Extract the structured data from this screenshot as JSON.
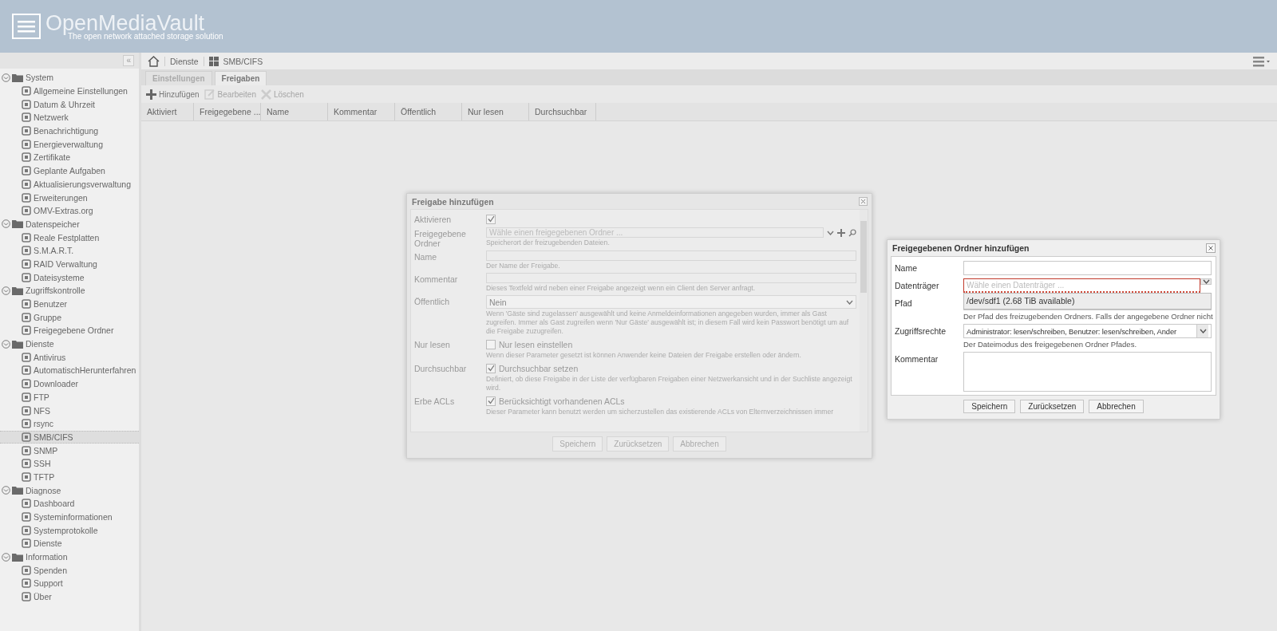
{
  "header": {
    "logo": "OpenMediaVault",
    "tagline": "The open network attached storage solution"
  },
  "sidebar": {
    "collapse": "«",
    "items": [
      {
        "label": "System",
        "expanded": true,
        "children": [
          {
            "label": "Allgemeine Einstellungen",
            "selected": false
          },
          {
            "label": "Datum & Uhrzeit",
            "selected": false
          },
          {
            "label": "Netzwerk",
            "selected": false
          },
          {
            "label": "Benachrichtigung",
            "selected": false
          },
          {
            "label": "Energieverwaltung",
            "selected": false
          },
          {
            "label": "Zertifikate",
            "selected": false
          },
          {
            "label": "Geplante Aufgaben",
            "selected": false
          },
          {
            "label": "Aktualisierungsverwaltung",
            "selected": false
          },
          {
            "label": "Erweiterungen",
            "selected": false
          },
          {
            "label": "OMV-Extras.org",
            "selected": false
          }
        ]
      },
      {
        "label": "Datenspeicher",
        "expanded": true,
        "children": [
          {
            "label": "Reale Festplatten",
            "selected": false
          },
          {
            "label": "S.M.A.R.T.",
            "selected": false
          },
          {
            "label": "RAID Verwaltung",
            "selected": false
          },
          {
            "label": "Dateisysteme",
            "selected": false
          }
        ]
      },
      {
        "label": "Zugriffskontrolle",
        "expanded": true,
        "children": [
          {
            "label": "Benutzer",
            "selected": false
          },
          {
            "label": "Gruppe",
            "selected": false
          },
          {
            "label": "Freigegebene Ordner",
            "selected": false
          }
        ]
      },
      {
        "label": "Dienste",
        "expanded": true,
        "children": [
          {
            "label": "Antivirus",
            "selected": false
          },
          {
            "label": "AutomatischHerunterfahren",
            "selected": false
          },
          {
            "label": "Downloader",
            "selected": false
          },
          {
            "label": "FTP",
            "selected": false
          },
          {
            "label": "NFS",
            "selected": false
          },
          {
            "label": "rsync",
            "selected": false
          },
          {
            "label": "SMB/CIFS",
            "selected": true
          },
          {
            "label": "SNMP",
            "selected": false
          },
          {
            "label": "SSH",
            "selected": false
          },
          {
            "label": "TFTP",
            "selected": false
          }
        ]
      },
      {
        "label": "Diagnose",
        "expanded": true,
        "children": [
          {
            "label": "Dashboard",
            "selected": false
          },
          {
            "label": "Systeminformationen",
            "selected": false
          },
          {
            "label": "Systemprotokolle",
            "selected": false
          },
          {
            "label": "Dienste",
            "selected": false
          }
        ]
      },
      {
        "label": "Information",
        "expanded": true,
        "children": [
          {
            "label": "Spenden",
            "selected": false
          },
          {
            "label": "Support",
            "selected": false
          },
          {
            "label": "Über",
            "selected": false
          }
        ]
      }
    ]
  },
  "breadcrumb": [
    "Dienste",
    "SMB/CIFS"
  ],
  "tabs": [
    {
      "label": "Einstellungen",
      "selected": false
    },
    {
      "label": "Freigaben",
      "selected": true
    }
  ],
  "toolbar": [
    {
      "label": "Hinzufügen",
      "kind": "add",
      "disabled": false
    },
    {
      "label": "Bearbeiten",
      "kind": "edit",
      "disabled": true
    },
    {
      "label": "Löschen",
      "kind": "delete",
      "disabled": true
    }
  ],
  "table": {
    "columns": [
      "Aktiviert",
      "Freigegebene ...",
      "Name",
      "Kommentar",
      "Öffentlich",
      "Nur lesen",
      "Durchsuchbar"
    ]
  },
  "share_dialog": {
    "title": "Freigabe hinzufügen",
    "fields": [
      {
        "kind": "checkbox",
        "label": "Aktivieren",
        "checked": true
      },
      {
        "kind": "combo",
        "label": "Freigegebene Ordner",
        "placeholder": "Wähle einen freigegebenen Ordner ...",
        "hint": "Speicherort der freizugebenden Dateien."
      },
      {
        "kind": "text",
        "label": "Name",
        "hint": "Der Name der Freigabe."
      },
      {
        "kind": "text",
        "label": "Kommentar",
        "hint": "Dieses Textfeld wird neben einer Freigabe angezeigt wenn ein Client den Server anfragt."
      },
      {
        "kind": "select",
        "label": "Öffentlich",
        "value": "Nein",
        "hint": "Wenn 'Gäste sind zugelassen' ausgewählt und keine Anmeldeinformationen angegeben wurden, immer als Gast zugreifen. Immer als Gast zugreifen wenn 'Nur Gäste' ausgewählt ist; in diesem Fall wird kein Passwort benötigt um auf die Freigabe zuzugreifen."
      },
      {
        "kind": "checkbox",
        "label": "Nur lesen",
        "checked": false,
        "box_label": "Nur lesen einstellen",
        "hint": "Wenn dieser Parameter gesetzt ist können Anwender keine Dateien der Freigabe erstellen oder ändern."
      },
      {
        "kind": "checkbox",
        "label": "Durchsuchbar",
        "checked": true,
        "box_label": "Durchsuchbar setzen",
        "hint": "Definiert, ob diese Freigabe in der Liste der verfügbaren Freigaben einer Netzwerkansicht und in der Suchliste angezeigt wird."
      },
      {
        "kind": "checkbox",
        "label": "Erbe ACLs",
        "checked": true,
        "box_label": "Berücksichtigt vorhandenen ACLs",
        "hint": "Dieser Parameter kann benutzt werden um sicherzustellen das existierende ACLs von Elternverzeichnissen immer"
      }
    ],
    "buttons": [
      "Speichern",
      "Zurücksetzen",
      "Abbrechen"
    ]
  },
  "folder_dialog": {
    "title": "Freigegebenen Ordner hinzufügen",
    "fields": [
      {
        "kind": "text",
        "label": "Name"
      },
      {
        "kind": "combo",
        "label": "Datenträger",
        "placeholder": "Wähle einen Datenträger ...",
        "invalid": true,
        "options": [
          "/dev/sdf1 (2.68 TiB available)"
        ]
      },
      {
        "kind": "text",
        "label": "Pfad",
        "hint": "Der Pfad des freizugebenden Ordners. Falls der angegebene Ordner nicht"
      },
      {
        "kind": "select",
        "label": "Zugriffsrechte",
        "value": "Administrator: lesen/schreiben, Benutzer: lesen/schreiben, Ander",
        "hint": "Der Dateimodus des freigegebenen Ordner Pfades."
      },
      {
        "kind": "textarea",
        "label": "Kommentar"
      }
    ],
    "buttons": [
      "Speichern",
      "Zurücksetzen",
      "Abbrechen"
    ]
  }
}
